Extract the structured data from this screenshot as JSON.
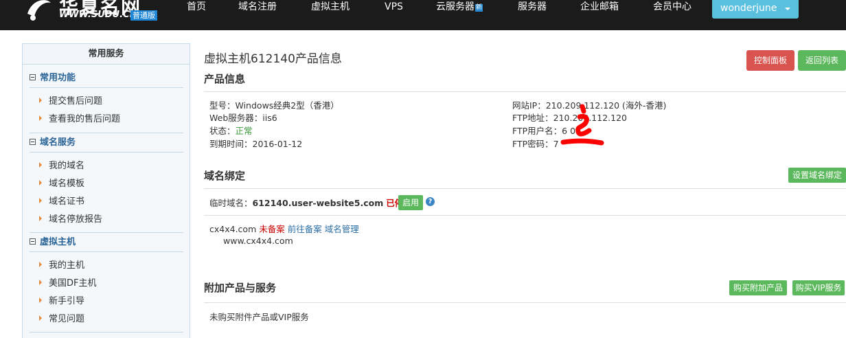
{
  "brand": {
    "title": "华夏名网",
    "url": "WWW.SUDU.CN",
    "edition": "普通版"
  },
  "nav": [
    {
      "label": "首页"
    },
    {
      "label": "域名注册"
    },
    {
      "label": "虚拟主机"
    },
    {
      "label": "VPS"
    },
    {
      "label": "云服务器",
      "badge": "新"
    },
    {
      "label": "服务器"
    },
    {
      "label": "企业邮箱"
    },
    {
      "label": "会员中心"
    }
  ],
  "user": {
    "name": "wonderjune"
  },
  "sidebar": {
    "title": "常用服务",
    "groups": [
      {
        "title": "常用功能",
        "items": [
          "提交售后问题",
          "查看我的售后问题"
        ]
      },
      {
        "title": "域名服务",
        "items": [
          "我的域名",
          "域名模板",
          "域名证书",
          "域名停放报告"
        ]
      },
      {
        "title": "虚拟主机",
        "items": [
          "我的主机",
          "美国DF主机",
          "新手引导",
          "常见问题"
        ]
      }
    ]
  },
  "page": {
    "title": "虚拟主机612140产品信息",
    "buttons": {
      "control_panel": "控制面板",
      "back_list": "返回列表"
    }
  },
  "product": {
    "section_title": "产品信息",
    "model": "型号：Windows经典2型（香港）",
    "web_server": "Web服务器：iis6",
    "status_label": "状态：",
    "status_value": "正常",
    "expiry": "到期时间：2016-01-12",
    "site_ip": "网站IP：210.209.112.120 (海外-香港)",
    "ftp_addr": "FTP地址：210.209.112.120",
    "ftp_user": "FTP用户名：6      0",
    "ftp_pass": "FTP密码：7"
  },
  "domain_binding": {
    "section_title": "域名绑定",
    "setup_button": "设置域名绑定",
    "temp_label": "临时域名：",
    "temp_domain": "612140.user-website5.com",
    "temp_status": "已停用",
    "enable_button": "启用",
    "help_icon": "?",
    "domain": "cx4x4.com",
    "domain_status": "未备案",
    "goto_icp": "前往备案",
    "manage": "域名管理",
    "sub_domain": "www.cx4x4.com"
  },
  "addons": {
    "section_title": "附加产品与服务",
    "buy_addon": "购买附加产品",
    "buy_vip": "购买VIP服务",
    "empty_text": "未购买附件产品或VIP服务"
  },
  "colors": {
    "navbar": "#1b1b1b",
    "accent_blue": "#5bc0de",
    "danger": "#d9534f",
    "success": "#5cb85c",
    "scribble": "#ff0000"
  }
}
